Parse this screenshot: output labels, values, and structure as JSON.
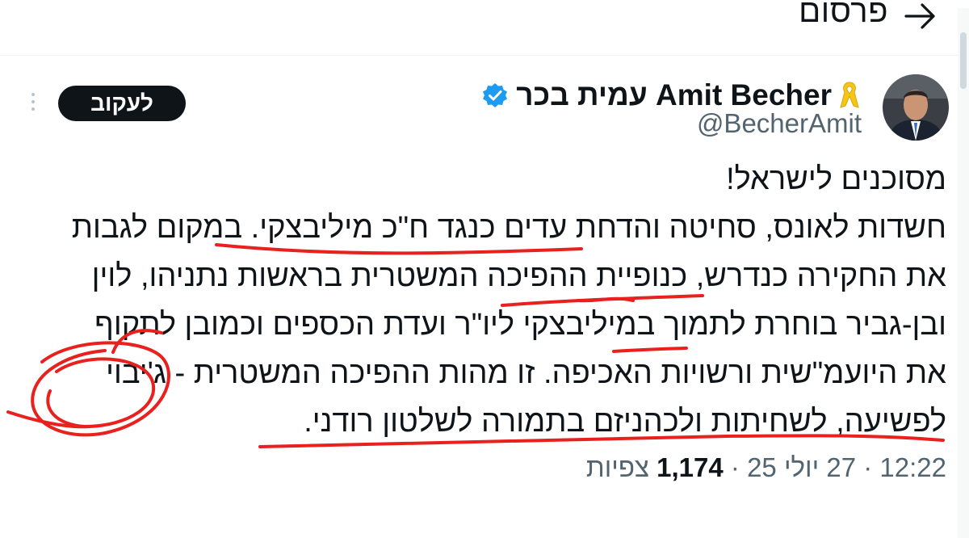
{
  "header": {
    "title": "פרסום",
    "back_icon": "arrow-right-icon"
  },
  "author": {
    "display_name": "עמית בכר Amit Becher",
    "handle": "@BecherAmit",
    "badge_icon": "yellow-ribbon-icon",
    "verified_icon": "verified-badge-icon",
    "verified_color": "#1d9bf0"
  },
  "follow_label": "לעקוב",
  "tweet": {
    "lines": [
      "מסוכנים לישראל!",
      "חשדות לאונס, סחיטה והדחת עדים כנגד ח\"כ מיליבצקי. במקום לגבות",
      "את החקירה כנדרש, כנופיית ההפיכה המשטרית בראשות נתניהו, לוין",
      "ובן-גביר בוחרת לתמוך במיליבצקי ליו\"ר ועדת הכספים וכמובן לתקוף",
      "את היועמ\"שית ורשויות האכיפה. זו מהות ההפיכה המשטרית - ג'יבוי",
      "לפשיעה, לשחיתות ולכהניזם בתמורה לשלטון רודני."
    ]
  },
  "meta": {
    "time": "12:22",
    "date": "27 יולי 25",
    "views_count": "1,174",
    "views_label": "צפיות"
  },
  "colors": {
    "annotation": "#e8211f",
    "text": "#0f1419",
    "secondary": "#536471"
  }
}
